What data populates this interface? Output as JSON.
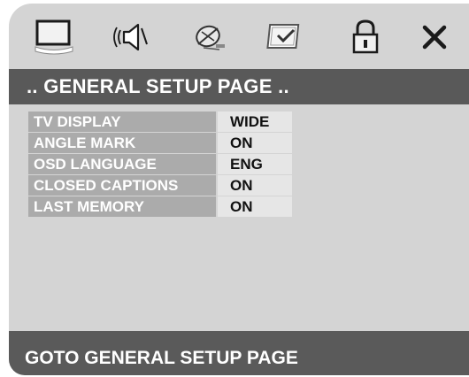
{
  "icons": [
    "monitor-icon",
    "speaker-icon",
    "dolby-icon",
    "preferences-icon",
    "lock-icon",
    "close-icon"
  ],
  "header": {
    "title": ".. GENERAL SETUP PAGE .."
  },
  "menu": {
    "items": [
      {
        "label": "TV DISPLAY",
        "value": "WIDE"
      },
      {
        "label": "ANGLE MARK",
        "value": "ON"
      },
      {
        "label": "OSD LANGUAGE",
        "value": "ENG"
      },
      {
        "label": "CLOSED CAPTIONS",
        "value": "ON"
      },
      {
        "label": "LAST MEMORY",
        "value": "ON"
      }
    ]
  },
  "status": {
    "text": "GOTO GENERAL SETUP PAGE"
  },
  "colors": {
    "background": "#d4d4d4",
    "title_bar": "#595959",
    "label_bg": "#ababab",
    "value_bg": "#e6e6e6"
  }
}
